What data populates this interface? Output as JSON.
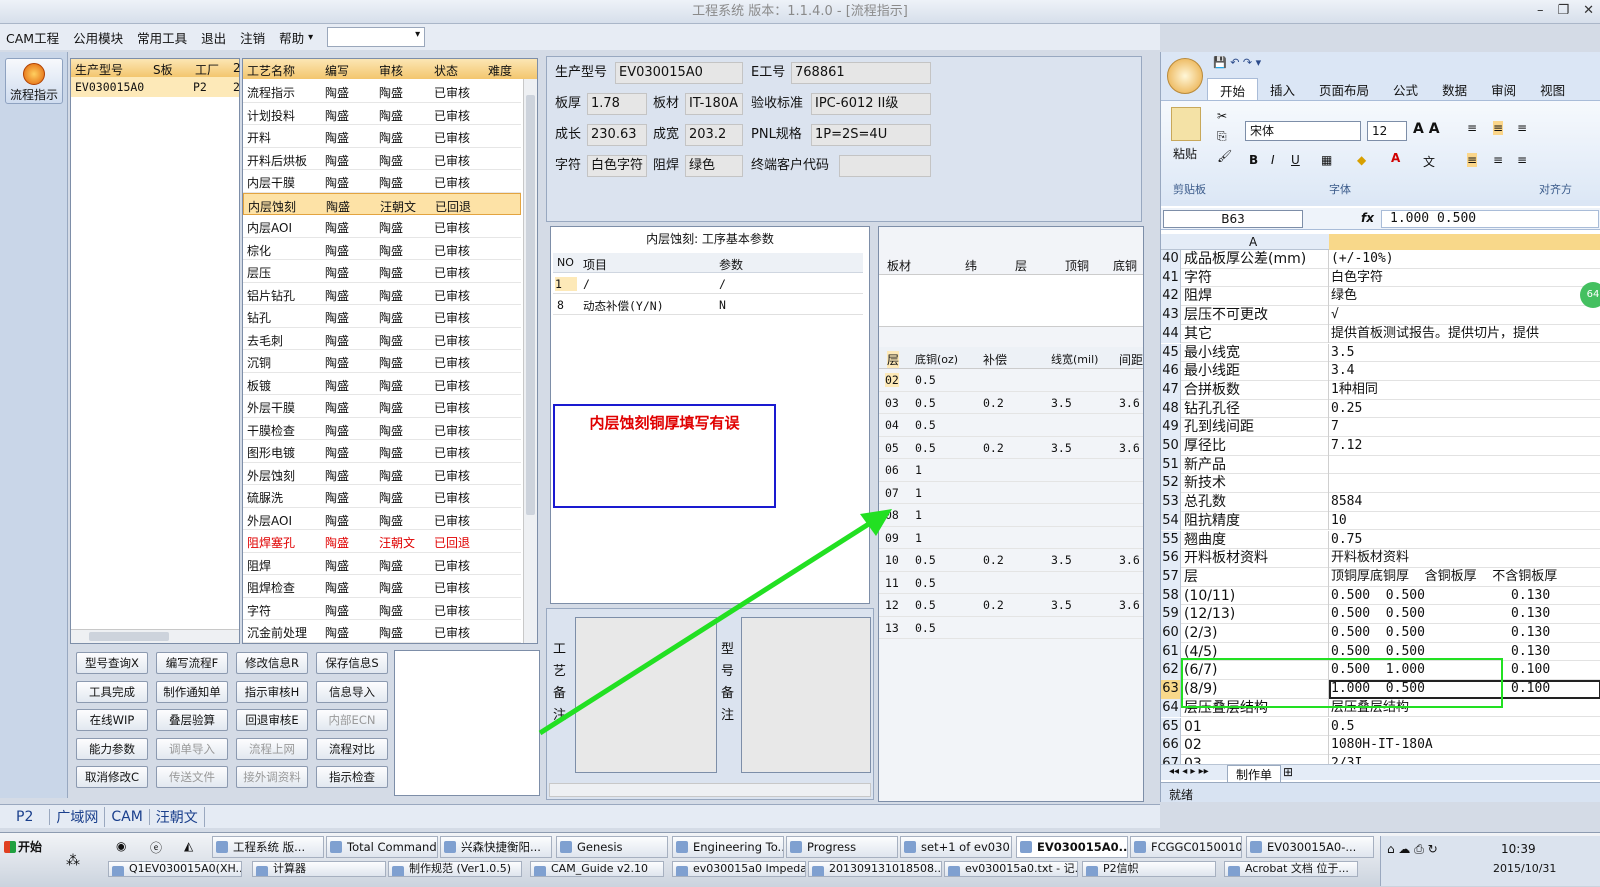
{
  "window": {
    "title": "工程系统  版本：1.1.4.0 - [流程指示]"
  },
  "menu": {
    "items": [
      "CAM工程",
      "公用模块",
      "常用工具",
      "退出",
      "注销",
      "帮助"
    ],
    "arrow": "▾"
  },
  "leftbar": {
    "button_label": "流程指示"
  },
  "product_list": {
    "headers": [
      "生产型号",
      "S板",
      "工厂",
      "2"
    ],
    "row": {
      "model": "EV030015A0",
      "factory": "P2",
      "extra": "2"
    }
  },
  "process_list": {
    "headers": [
      "工艺名称",
      "编写",
      "审核",
      "状态",
      "难度"
    ],
    "rows": [
      {
        "name": "流程指示",
        "writer": "陶盛",
        "reviewer": "陶盛",
        "status": "已审核",
        "state": "normal"
      },
      {
        "name": "计划投料",
        "writer": "陶盛",
        "reviewer": "陶盛",
        "status": "已审核",
        "state": "normal"
      },
      {
        "name": "开料",
        "writer": "陶盛",
        "reviewer": "陶盛",
        "status": "已审核",
        "state": "normal"
      },
      {
        "name": "开料后烘板",
        "writer": "陶盛",
        "reviewer": "陶盛",
        "status": "已审核",
        "state": "normal"
      },
      {
        "name": "内层干膜",
        "writer": "陶盛",
        "reviewer": "陶盛",
        "status": "已审核",
        "state": "normal"
      },
      {
        "name": "内层蚀刻",
        "writer": "陶盛",
        "reviewer": "汪朝文",
        "status": "已回退",
        "state": "selected"
      },
      {
        "name": "内层AOI",
        "writer": "陶盛",
        "reviewer": "陶盛",
        "status": "已审核",
        "state": "normal"
      },
      {
        "name": "棕化",
        "writer": "陶盛",
        "reviewer": "陶盛",
        "status": "已审核",
        "state": "normal"
      },
      {
        "name": "层压",
        "writer": "陶盛",
        "reviewer": "陶盛",
        "status": "已审核",
        "state": "normal"
      },
      {
        "name": "铝片钻孔",
        "writer": "陶盛",
        "reviewer": "陶盛",
        "status": "已审核",
        "state": "normal"
      },
      {
        "name": "钻孔",
        "writer": "陶盛",
        "reviewer": "陶盛",
        "status": "已审核",
        "state": "normal"
      },
      {
        "name": "去毛刺",
        "writer": "陶盛",
        "reviewer": "陶盛",
        "status": "已审核",
        "state": "normal"
      },
      {
        "name": "沉铜",
        "writer": "陶盛",
        "reviewer": "陶盛",
        "status": "已审核",
        "state": "normal"
      },
      {
        "name": "板镀",
        "writer": "陶盛",
        "reviewer": "陶盛",
        "status": "已审核",
        "state": "normal"
      },
      {
        "name": "外层干膜",
        "writer": "陶盛",
        "reviewer": "陶盛",
        "status": "已审核",
        "state": "normal"
      },
      {
        "name": "干膜检查",
        "writer": "陶盛",
        "reviewer": "陶盛",
        "status": "已审核",
        "state": "normal"
      },
      {
        "name": "图形电镀",
        "writer": "陶盛",
        "reviewer": "陶盛",
        "status": "已审核",
        "state": "normal"
      },
      {
        "name": "外层蚀刻",
        "writer": "陶盛",
        "reviewer": "陶盛",
        "status": "已审核",
        "state": "normal"
      },
      {
        "name": "硫脲洗",
        "writer": "陶盛",
        "reviewer": "陶盛",
        "status": "已审核",
        "state": "normal"
      },
      {
        "name": "外层AOI",
        "writer": "陶盛",
        "reviewer": "陶盛",
        "status": "已审核",
        "state": "normal"
      },
      {
        "name": "阻焊塞孔",
        "writer": "陶盛",
        "reviewer": "汪朝文",
        "status": "已回退",
        "state": "returned"
      },
      {
        "name": "阻焊",
        "writer": "陶盛",
        "reviewer": "陶盛",
        "status": "已审核",
        "state": "normal"
      },
      {
        "name": "阻焊检查",
        "writer": "陶盛",
        "reviewer": "陶盛",
        "status": "已审核",
        "state": "normal"
      },
      {
        "name": "字符",
        "writer": "陶盛",
        "reviewer": "陶盛",
        "status": "已审核",
        "state": "normal"
      },
      {
        "name": "沉金前处理",
        "writer": "陶盛",
        "reviewer": "陶盛",
        "status": "已审核",
        "state": "normal"
      }
    ]
  },
  "action_buttons": [
    [
      "型号查询X",
      "编写流程F",
      "修改信息R",
      "保存信息S"
    ],
    [
      "工具完成",
      "制作通知单",
      "指示审核H",
      "信息导入"
    ],
    [
      "在线WIP",
      "叠层验算",
      "回退审核E",
      "内部ECN"
    ],
    [
      "能力参数",
      "调单导入",
      "流程上网",
      "流程对比"
    ],
    [
      "取消修改C",
      "传送文件",
      "接外调资料",
      "指示检查"
    ]
  ],
  "info": {
    "model_label": "生产型号",
    "model": "EV030015A0",
    "eno_label": "E工号",
    "eno": "768861",
    "thick_label": "板厚",
    "thick": "1.78",
    "material_label": "板材",
    "material": "IT-180A",
    "std_label": "验收标准",
    "std": "IPC-6012 II级",
    "len_label": "成长",
    "len": "230.63",
    "wid_label": "成宽",
    "wid": "203.2",
    "pnl_label": "PNL规格",
    "pnl": "1P=2S=4U",
    "char_label": "字符",
    "char": "白色字符",
    "mask_label": "阻焊",
    "mask": "绿色",
    "cust_label": "终端客户代码",
    "cust": ""
  },
  "params": {
    "title": "内层蚀刻: 工序基本参数",
    "headers": [
      "NO",
      "项目",
      "参数"
    ],
    "rows": [
      {
        "no": "1",
        "item": "/",
        "value": "/"
      },
      {
        "no": "8",
        "item": "动态补偿(Y/N)",
        "value": "N"
      }
    ],
    "note": "内层蚀刻铜厚填写有误"
  },
  "remarks": {
    "process_label": "工艺备注",
    "model_label": "型号备注"
  },
  "board": {
    "headers": [
      "板材",
      "纬",
      "层",
      "顶铜",
      "底铜"
    ]
  },
  "layers": {
    "headers": [
      "层",
      "底铜(oz)",
      "补偿",
      "线宽(mil)",
      "间距"
    ],
    "rows": [
      {
        "layer": "02",
        "cu": "0.5",
        "comp": "",
        "width": "",
        "gap": ""
      },
      {
        "layer": "03",
        "cu": "0.5",
        "comp": "0.2",
        "width": "3.5",
        "gap": "3.6"
      },
      {
        "layer": "04",
        "cu": "0.5",
        "comp": "",
        "width": "",
        "gap": ""
      },
      {
        "layer": "05",
        "cu": "0.5",
        "comp": "0.2",
        "width": "3.5",
        "gap": "3.6"
      },
      {
        "layer": "06",
        "cu": "1",
        "comp": "",
        "width": "",
        "gap": ""
      },
      {
        "layer": "07",
        "cu": "1",
        "comp": "",
        "width": "",
        "gap": ""
      },
      {
        "layer": "08",
        "cu": "1",
        "comp": "",
        "width": "",
        "gap": ""
      },
      {
        "layer": "09",
        "cu": "1",
        "comp": "",
        "width": "",
        "gap": ""
      },
      {
        "layer": "10",
        "cu": "0.5",
        "comp": "0.2",
        "width": "3.5",
        "gap": "3.6"
      },
      {
        "layer": "11",
        "cu": "0.5",
        "comp": "",
        "width": "",
        "gap": ""
      },
      {
        "layer": "12",
        "cu": "0.5",
        "comp": "0.2",
        "width": "3.5",
        "gap": "3.6"
      },
      {
        "layer": "13",
        "cu": "0.5",
        "comp": "",
        "width": "",
        "gap": ""
      }
    ]
  },
  "excel": {
    "tabs": [
      "开始",
      "插入",
      "页面布局",
      "公式",
      "数据",
      "审阅",
      "视图"
    ],
    "font": "宋体",
    "size": "12",
    "groups": [
      "剪贴板",
      "字体",
      "对齐方"
    ],
    "paste": "粘贴",
    "namebox": "B63",
    "fx": "fx",
    "formula": "1.000  0.500",
    "col_a": "A",
    "badge": "64",
    "rows": [
      {
        "n": "40",
        "a": "成品板厚公差(mm)",
        "b": "(+/-10%)"
      },
      {
        "n": "41",
        "a": "字符",
        "b": "白色字符"
      },
      {
        "n": "42",
        "a": "阻焊",
        "b": "绿色"
      },
      {
        "n": "43",
        "a": "层压不可更改",
        "b": "√"
      },
      {
        "n": "44",
        "a": "其它",
        "b": "提供首板测试报告。提供切片，提供"
      },
      {
        "n": "45",
        "a": "最小线宽",
        "b": "3.5"
      },
      {
        "n": "46",
        "a": "最小线距",
        "b": "3.4"
      },
      {
        "n": "47",
        "a": "合拼板数",
        "b": "1种相同"
      },
      {
        "n": "48",
        "a": "钻孔孔径",
        "b": "0.25"
      },
      {
        "n": "49",
        "a": "孔到线间距",
        "b": "7"
      },
      {
        "n": "50",
        "a": "厚径比",
        "b": "7.12"
      },
      {
        "n": "51",
        "a": "新产品",
        "b": ""
      },
      {
        "n": "52",
        "a": "新技术",
        "b": ""
      },
      {
        "n": "53",
        "a": "总孔数",
        "b": "8584"
      },
      {
        "n": "54",
        "a": "阻抗精度",
        "b": "10"
      },
      {
        "n": "55",
        "a": "翘曲度",
        "b": "0.75"
      },
      {
        "n": "56",
        "a": "开料板材资料",
        "b": "开料板材资料"
      },
      {
        "n": "57",
        "a": "层",
        "b": "顶铜厚底铜厚  含铜板厚  不含铜板厚"
      },
      {
        "n": "58",
        "a": "(10/11)",
        "b": "0.500  0.500           0.130"
      },
      {
        "n": "59",
        "a": "(12/13)",
        "b": "0.500  0.500           0.130"
      },
      {
        "n": "60",
        "a": "(2/3)",
        "b": "0.500  0.500           0.130"
      },
      {
        "n": "61",
        "a": "(4/5)",
        "b": "0.500  0.500           0.130"
      },
      {
        "n": "62",
        "a": "(6/7)",
        "b": "0.500  1.000           0.100"
      },
      {
        "n": "63",
        "a": "(8/9)",
        "b": "1.000  0.500           0.100"
      },
      {
        "n": "64",
        "a": "层压叠层结构",
        "b": "层压叠层结构"
      },
      {
        "n": "65",
        "a": "01",
        "b": "0.5"
      },
      {
        "n": "66",
        "a": "02",
        "b": "1080H-IT-180A"
      },
      {
        "n": "67",
        "a": "03",
        "b": "2/3I"
      }
    ],
    "sheet_tab": "制作单",
    "status": "就绪"
  },
  "bottom_tabs": [
    "P2",
    "广域网",
    "CAM",
    "汪朝文"
  ],
  "taskbar": {
    "start": "开始",
    "row1": [
      "工程系统  版...",
      "Total Command...",
      "兴森快捷衡阳...",
      "Genesis",
      "Engineering To...",
      "Progress",
      "set+1 of ev030...",
      "EV030015A0...",
      "FCGGC0150010...",
      "EV030015A0-..."
    ],
    "row2": [
      "Q1EV030015A0(XH...",
      "计算器",
      "制作规范 (Ver1.0.5)",
      "CAM_Guide v2.10",
      "ev030015a0 Impeda...",
      "201309131018508...",
      "ev030015a0.txt - 记...",
      "P2信帜",
      "Acrobat 文档 位于..."
    ],
    "time": "10:39",
    "date": "2015/10/31"
  },
  "colors": {
    "accent": "#f3c66e",
    "returned": "#e00000",
    "arrow": "#22e022",
    "note_border": "#1a1ad0",
    "note_text": "#e00000"
  }
}
